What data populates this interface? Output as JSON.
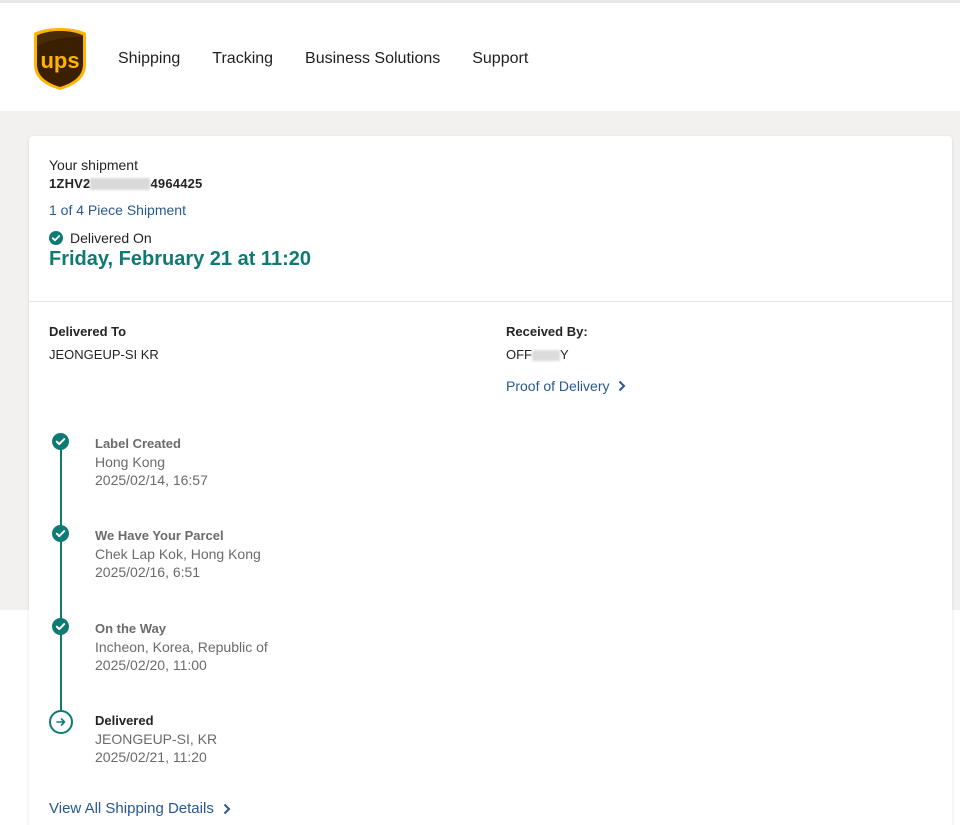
{
  "brand": {
    "logo_text": "ups",
    "logo_name": "ups-shield-logo"
  },
  "nav": {
    "items": [
      {
        "label": "Shipping"
      },
      {
        "label": "Tracking"
      },
      {
        "label": "Business Solutions"
      },
      {
        "label": "Support"
      }
    ]
  },
  "shipment": {
    "label": "Your shipment",
    "number_prefix": "1ZHV2",
    "number_suffix": "4964425",
    "piece_link": "1 of 4 Piece Shipment",
    "status_label": "Delivered On",
    "delivered_date": "Friday, February 21 at 11:20"
  },
  "delivery": {
    "to_label": "Delivered To",
    "to_value": "JEONGEUP-SI KR",
    "received_label": "Received By:",
    "received_prefix": "OFF",
    "received_suffix": "Y",
    "proof_link": "Proof of Delivery"
  },
  "events": [
    {
      "title": "Label Created",
      "location": "Hong Kong",
      "time": "2025/02/14, 16:57",
      "state": "done"
    },
    {
      "title": "We Have Your Parcel",
      "location": "Chek Lap Kok, Hong Kong",
      "time": "2025/02/16, 6:51",
      "state": "done"
    },
    {
      "title": "On the Way",
      "location": "Incheon, Korea, Republic of",
      "time": "2025/02/20, 11:00",
      "state": "done"
    },
    {
      "title": "Delivered",
      "location": "JEONGEUP-SI, KR",
      "time": "2025/02/21, 11:20",
      "state": "current"
    }
  ],
  "footer": {
    "view_all_link": "View All Shipping Details"
  },
  "colors": {
    "teal": "#0f7a74",
    "link": "#28588f",
    "ups_brown": "#3b2000",
    "ups_gold": "#ffb500",
    "page_gray": "#f2f1ef"
  }
}
